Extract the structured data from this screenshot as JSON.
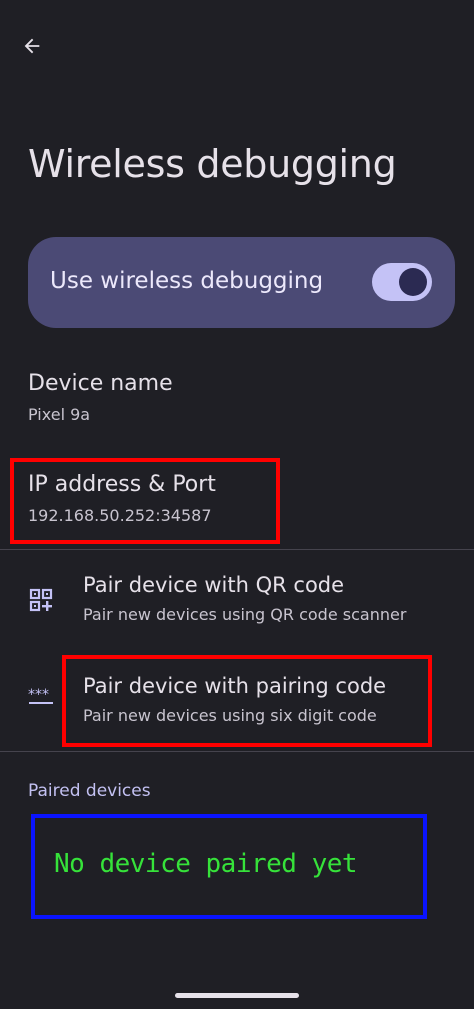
{
  "header": {
    "back_icon": "arrow-back-icon",
    "title": "Wireless debugging"
  },
  "toggle": {
    "label": "Use wireless debugging",
    "enabled": true,
    "track_color": "#c4c2f6",
    "card_color": "#4b4a75"
  },
  "device": {
    "name_title": "Device name",
    "name_value": "Pixel 9a",
    "ip_title": "IP address & Port",
    "ip_value": "192.168.50.252:34587"
  },
  "pairing": {
    "qr": {
      "icon": "qr-code-scanner-icon",
      "title": "Pair device with QR code",
      "subtitle": "Pair new devices using QR code scanner"
    },
    "code": {
      "icon": "password-dots-icon",
      "title": "Pair device with pairing code",
      "subtitle": "Pair new devices using six digit code"
    }
  },
  "paired": {
    "section_title": "Paired devices",
    "empty_message": "No device paired yet",
    "empty_color": "#36e23a"
  },
  "annotations": {
    "red": "#ff0000",
    "blue": "#0a14ff"
  }
}
